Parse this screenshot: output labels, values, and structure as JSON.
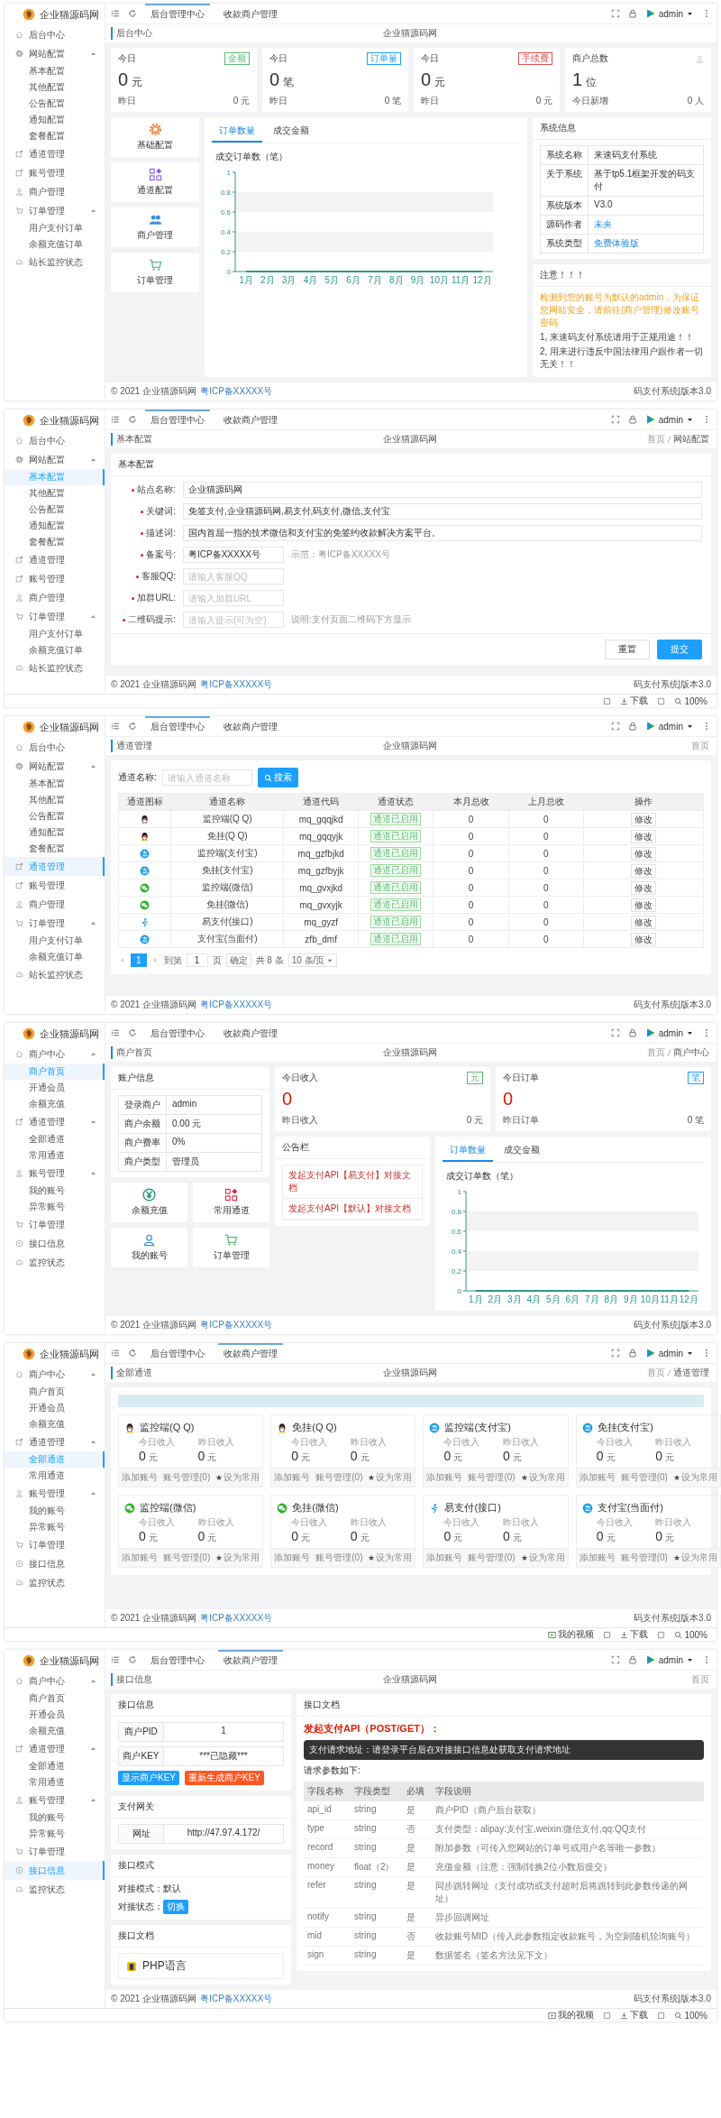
{
  "screens": [
    {
      "kind": "dashboard",
      "brand": "企业猫源码网",
      "user": "admin",
      "tabs": [
        {
          "label": "后台管理中心",
          "selected": true
        },
        {
          "label": "收款商户管理",
          "selected": false
        }
      ],
      "sidebar": [
        {
          "label": "后台中心",
          "kind": "home",
          "selected": false
        },
        {
          "label": "网站配置",
          "kind": "settings",
          "selected": false,
          "expanded": true,
          "children": [
            {
              "label": "基本配置",
              "selected": false
            },
            {
              "label": "其他配置",
              "selected": false
            },
            {
              "label": "公告配置",
              "selected": false
            },
            {
              "label": "通知配置",
              "selected": false
            },
            {
              "label": "套餐配置",
              "selected": false
            }
          ]
        },
        {
          "label": "通道管理",
          "kind": "channel",
          "selected": false
        },
        {
          "label": "账号管理",
          "kind": "channel",
          "selected": false
        },
        {
          "label": "商户管理",
          "kind": "user",
          "selected": false
        },
        {
          "label": "订单管理",
          "kind": "cart",
          "selected": false,
          "expanded": true,
          "children": [
            {
              "label": "用户支付订单",
              "selected": false
            },
            {
              "label": "余额充值订单",
              "selected": false
            }
          ]
        },
        {
          "label": "站长监控状态",
          "kind": "monitor",
          "selected": false
        }
      ],
      "breadcrumb": {
        "title": "后台中心",
        "site": "企业猫源码网"
      },
      "content": {
        "stats": [
          {
            "kind": "badge",
            "label": "今日",
            "badge": "金额",
            "color": "#5fb878",
            "value": "0",
            "unit": "元",
            "sub_label": "昨日",
            "sub_value": "0 元"
          },
          {
            "kind": "badge",
            "label": "今日",
            "badge": "订单量",
            "color": "#1e9fff",
            "value": "0",
            "unit": "笔",
            "sub_label": "昨日",
            "sub_value": "0 笔"
          },
          {
            "kind": "badge",
            "label": "今日",
            "badge": "手续费",
            "color": "#e0504a",
            "value": "0",
            "unit": "元",
            "sub_label": "昨日",
            "sub_value": "0 元"
          },
          {
            "kind": "icon",
            "label": "商户总数",
            "value": "1",
            "unit": "位",
            "sub_label": "今日新增",
            "sub_value": "0 人"
          }
        ],
        "shortcuts": [
          {
            "label": "基础配置",
            "kind": "settings",
            "color": "#ee8a4c"
          },
          {
            "label": "通道配置",
            "kind": "grid",
            "color": "#8b5cf6"
          },
          {
            "label": "商户管理",
            "kind": "users",
            "color": "#3b8fd8"
          },
          {
            "label": "订单管理",
            "kind": "cart",
            "color": "#5fb878"
          }
        ],
        "chart_tabs": [
          {
            "label": "订单数量",
            "selected": true
          },
          {
            "label": "成交金额",
            "selected": false
          }
        ],
        "chart_data": {
          "type": "line",
          "title": "成交订单数（笔）",
          "categories": [
            "1月",
            "2月",
            "3月",
            "4月",
            "5月",
            "6月",
            "7月",
            "8月",
            "9月",
            "10月",
            "11月",
            "12月"
          ],
          "ylim": [
            0,
            1
          ],
          "yticks": [
            0,
            0.2,
            0.4,
            0.6,
            0.8,
            1
          ],
          "series": [
            {
              "color": "#2f9688",
              "values": [
                0,
                0,
                0,
                0,
                0,
                0,
                0,
                0,
                0,
                0,
                0,
                0
              ]
            }
          ]
        },
        "system_info": {
          "title": "系统信息",
          "rows": [
            {
              "key": "系统名称",
              "value": "来速码支付系统",
              "kind": "text"
            },
            {
              "key": "关于系统",
              "value": "基于tp5.1框架开发的码支付",
              "kind": "text"
            },
            {
              "key": "系统版本",
              "value": "V3.0",
              "kind": "text"
            },
            {
              "key": "源码作者",
              "value": "未央",
              "kind": "link"
            },
            {
              "key": "系统类型",
              "value": "免费体验版",
              "kind": "link"
            }
          ]
        },
        "notice": {
          "title": "注意！！！",
          "warning": "检测到您的账号为默认的admin，为保证您网站安全，请前往(商户管理)修改账号密码",
          "lines": [
            "1, 来速码支付系统请用于正规用途！！",
            "2, 用来进行违反中国法律用户跟作者一切无关！！"
          ]
        }
      },
      "footer": {
        "copyright": "© 2021 企业猫源码网",
        "icp": "粤ICP备XXXXX号",
        "version": "码支付系统|版本3.0"
      }
    },
    {
      "kind": "form",
      "brand": "企业猫源码网",
      "user": "admin",
      "tabs": [
        {
          "label": "后台管理中心",
          "selected": true
        },
        {
          "label": "收款商户管理",
          "selected": false
        }
      ],
      "sidebar": [
        {
          "label": "后台中心",
          "kind": "home",
          "selected": false
        },
        {
          "label": "网站配置",
          "kind": "settings",
          "selected": false,
          "expanded": true,
          "children": [
            {
              "label": "基本配置",
              "selected": true
            },
            {
              "label": "其他配置",
              "selected": false
            },
            {
              "label": "公告配置",
              "selected": false
            },
            {
              "label": "通知配置",
              "selected": false
            },
            {
              "label": "套餐配置",
              "selected": false
            }
          ]
        },
        {
          "label": "通道管理",
          "kind": "channel",
          "selected": false
        },
        {
          "label": "账号管理",
          "kind": "channel",
          "selected": false
        },
        {
          "label": "商户管理",
          "kind": "user",
          "selected": false
        },
        {
          "label": "订单管理",
          "kind": "cart",
          "selected": false,
          "expanded": true,
          "children": [
            {
              "label": "用户支付订单",
              "selected": false
            },
            {
              "label": "余额充值订单",
              "selected": false
            }
          ]
        },
        {
          "label": "站长监控状态",
          "kind": "monitor",
          "selected": false
        }
      ],
      "breadcrumb": {
        "title": "基本配置",
        "site": "企业猫源码网",
        "trail": [
          "首页",
          "网站配置"
        ]
      },
      "content": {
        "title": "基本配置",
        "fields": [
          {
            "label": "站点名称:",
            "required": true,
            "kind": "wide",
            "value": "企业猫源码网"
          },
          {
            "label": "关键词:",
            "required": true,
            "kind": "wide",
            "value": "免签支付,企业猫源码网,易支付,码支付,微信,支付宝"
          },
          {
            "label": "描述词:",
            "required": true,
            "kind": "wide",
            "value": "国内首屈一指的技术微信和支付宝的免签约收款解决方案平台。"
          },
          {
            "label": "备案号:",
            "required": true,
            "kind": "short",
            "value": "粤ICP备XXXXX号",
            "hint": "示范：粤ICP备XXXXX号"
          },
          {
            "label": "客服QQ:",
            "required": true,
            "kind": "short",
            "placeholder": "请输入客服QQ"
          },
          {
            "label": "加群URL:",
            "required": true,
            "kind": "short",
            "placeholder": "请输入加群URL"
          },
          {
            "label": "二维码提示:",
            "required": true,
            "kind": "short",
            "placeholder": "请输入提示(可为空)",
            "hint": "说明:支付页面二维码下方显示"
          }
        ],
        "buttons": [
          {
            "label": "重置",
            "kind": "plain"
          },
          {
            "label": "提交",
            "kind": "primary"
          }
        ]
      },
      "footer": {
        "copyright": "© 2021 企业猫源码网",
        "icp": "粤ICP备XXXXX号",
        "version": "码支付系统|版本3.0"
      },
      "status_bar": {
        "download": "下载",
        "zoom": "100%"
      }
    },
    {
      "kind": "table",
      "brand": "企业猫源码网",
      "user": "admin",
      "tabs": [
        {
          "label": "后台管理中心",
          "selected": true
        },
        {
          "label": "收款商户管理",
          "selected": false
        }
      ],
      "sidebar": [
        {
          "label": "后台中心",
          "kind": "home",
          "selected": false
        },
        {
          "label": "网站配置",
          "kind": "settings",
          "selected": false,
          "expanded": true,
          "children": [
            {
              "label": "基本配置",
              "selected": false
            },
            {
              "label": "其他配置",
              "selected": false
            },
            {
              "label": "公告配置",
              "selected": false
            },
            {
              "label": "通知配置",
              "selected": false
            },
            {
              "label": "套餐配置",
              "selected": false
            }
          ]
        },
        {
          "label": "通道管理",
          "kind": "channel",
          "selected": true
        },
        {
          "label": "账号管理",
          "kind": "channel",
          "selected": false
        },
        {
          "label": "商户管理",
          "kind": "user",
          "selected": false
        },
        {
          "label": "订单管理",
          "kind": "cart",
          "selected": false,
          "expanded": true,
          "children": [
            {
              "label": "用户支付订单",
              "selected": false
            },
            {
              "label": "余额充值订单",
              "selected": false
            }
          ]
        },
        {
          "label": "站长监控状态",
          "kind": "monitor",
          "selected": false
        }
      ],
      "breadcrumb": {
        "title": "通道管理",
        "site": "企业猫源码网",
        "trail": [
          "首页"
        ]
      },
      "content": {
        "search": {
          "label": "通道名称:",
          "placeholder": "请输入通道名称",
          "button": "搜索"
        },
        "columns": [
          "通道图标",
          "通道名称",
          "通道代码",
          "通道状态",
          "本月总收",
          "上月总收",
          "操作"
        ],
        "rows": [
          {
            "kind": "qq",
            "name": "监控端(Q Q)",
            "code": "mq_gqqjkd",
            "status": "通道已启用",
            "month": "0",
            "last_month": "0",
            "action": "修改"
          },
          {
            "kind": "qq",
            "name": "免挂(Q Q)",
            "code": "mq_gqqyjk",
            "status": "通道已启用",
            "month": "0",
            "last_month": "0",
            "action": "修改"
          },
          {
            "kind": "alipay",
            "name": "监控端(支付宝)",
            "code": "mq_gzfbjkd",
            "status": "通道已启用",
            "month": "0",
            "last_month": "0",
            "action": "修改"
          },
          {
            "kind": "alipay",
            "name": "免挂(支付宝)",
            "code": "mq_gzfbyjk",
            "status": "通道已启用",
            "month": "0",
            "last_month": "0",
            "action": "修改"
          },
          {
            "kind": "wechat",
            "name": "监控端(微信)",
            "code": "mq_gvxjkd",
            "status": "通道已启用",
            "month": "0",
            "last_month": "0",
            "action": "修改"
          },
          {
            "kind": "wechat",
            "name": "免挂(微信)",
            "code": "mq_gvxyjk",
            "status": "通道已启用",
            "month": "0",
            "last_month": "0",
            "action": "修改"
          },
          {
            "kind": "yzf",
            "name": "易支付(接口)",
            "code": "mq_gyzf",
            "status": "通道已启用",
            "month": "0",
            "last_month": "0",
            "action": "修改"
          },
          {
            "kind": "alipay",
            "name": "支付宝(当面付)",
            "code": "zfb_dmf",
            "status": "通道已启用",
            "month": "0",
            "last_month": "0",
            "action": "修改"
          }
        ],
        "pagination": {
          "pages": [
            {
              "label": "1",
              "selected": true
            }
          ],
          "goto_label": "到第",
          "goto_value": "1",
          "page_unit": "页",
          "confirm": "确定",
          "total": "共 8 条",
          "page_size": "10 条/页"
        }
      },
      "footer": {
        "copyright": "© 2021 企业猫源码网",
        "icp": "粤ICP备XXXXX号",
        "version": "码支付系统|版本3.0"
      }
    },
    {
      "kind": "merchant",
      "brand": "企业猫源码网",
      "user": "admin",
      "tabs": [
        {
          "label": "后台管理中心",
          "selected": false
        },
        {
          "label": "收款商户管理",
          "selected": false
        }
      ],
      "sidebar": [
        {
          "label": "商户中心",
          "kind": "home",
          "selected": false,
          "expanded": true,
          "children": [
            {
              "label": "商户首页",
              "selected": true
            },
            {
              "label": "开通会员",
              "selected": false
            },
            {
              "label": "余额充值",
              "selected": false
            }
          ]
        },
        {
          "label": "通道管理",
          "kind": "channel",
          "selected": false,
          "expanded": true,
          "children": [
            {
              "label": "全部通道",
              "selected": false
            },
            {
              "label": "常用通道",
              "selected": false
            }
          ]
        },
        {
          "label": "账号管理",
          "kind": "user",
          "selected": false,
          "expanded": true,
          "children": [
            {
              "label": "我的账号",
              "selected": false
            },
            {
              "label": "异常账号",
              "selected": false
            }
          ]
        },
        {
          "label": "订单管理",
          "kind": "cart",
          "selected": false
        },
        {
          "label": "接口信息",
          "kind": "info",
          "selected": false
        },
        {
          "label": "监控状态",
          "kind": "monitor",
          "selected": false
        }
      ],
      "breadcrumb": {
        "title": "商户首页",
        "site": "企业猫源码网",
        "trail": [
          "首页",
          "商户中心"
        ]
      },
      "content": {
        "account": {
          "title": "账户信息",
          "rows": [
            {
              "key": "登录商户",
              "value": "admin"
            },
            {
              "key": "商户余额",
              "value": "0.00 元"
            },
            {
              "key": "商户费率",
              "value": "0%"
            },
            {
              "key": "商户类型",
              "value": "管理员"
            }
          ]
        },
        "stats": [
          {
            "label": "今日收入",
            "badge": "元",
            "color": "#5fb878",
            "value": "0",
            "sub_label": "昨日收入",
            "sub_value": "0 元"
          },
          {
            "label": "今日订单",
            "badge": "笔",
            "color": "#1e9fff",
            "value": "0",
            "sub_label": "昨日订单",
            "sub_value": "0 笔"
          }
        ],
        "shortcuts": [
          {
            "label": "余额充值",
            "kind": "yen",
            "color": "#2f9688"
          },
          {
            "label": "常用通道",
            "kind": "grid",
            "color": "#e0284a"
          },
          {
            "label": "我的账号",
            "kind": "user",
            "color": "#3b8fd8"
          },
          {
            "label": "订单管理",
            "kind": "cart",
            "color": "#5fb878"
          }
        ],
        "bulletin": {
          "title": "公告栏",
          "links": [
            "发起支付API【易支付】对接文档",
            "发起支付API【默认】对接文档"
          ]
        },
        "chart_tabs": [
          {
            "label": "订单数量",
            "selected": true
          },
          {
            "label": "成交金额",
            "selected": false
          }
        ],
        "chart_data": {
          "type": "line",
          "title": "成交订单数（笔）",
          "categories": [
            "1月",
            "2月",
            "3月",
            "4月",
            "5月",
            "6月",
            "7月",
            "8月",
            "9月",
            "10月",
            "11月",
            "12月"
          ],
          "ylim": [
            0,
            1
          ],
          "yticks": [
            0,
            0.2,
            0.4,
            0.6,
            0.8,
            1
          ],
          "series": [
            {
              "color": "#2f9688",
              "values": [
                0,
                0,
                0,
                0,
                0,
                0,
                0,
                0,
                0,
                0,
                0,
                0
              ]
            }
          ]
        }
      },
      "footer": {
        "copyright": "© 2021 企业猫源码网",
        "icp": "粤ICP备XXXXX号",
        "version": "码支付系统|版本3.0"
      }
    },
    {
      "kind": "channels",
      "brand": "企业猫源码网",
      "user": "admin",
      "tabs": [
        {
          "label": "后台管理中心",
          "selected": false
        },
        {
          "label": "收款商户管理",
          "selected": true
        }
      ],
      "sidebar": [
        {
          "label": "商户中心",
          "kind": "home",
          "selected": false,
          "expanded": true,
          "children": [
            {
              "label": "商户首页",
              "selected": false
            },
            {
              "label": "开通会员",
              "selected": false
            },
            {
              "label": "余额充值",
              "selected": false
            }
          ]
        },
        {
          "label": "通道管理",
          "kind": "channel",
          "selected": false,
          "expanded": true,
          "children": [
            {
              "label": "全部通道",
              "selected": true
            },
            {
              "label": "常用通道",
              "selected": false
            }
          ]
        },
        {
          "label": "账号管理",
          "kind": "user",
          "selected": false,
          "expanded": true,
          "children": [
            {
              "label": "我的账号",
              "selected": false
            },
            {
              "label": "异常账号",
              "selected": false
            }
          ]
        },
        {
          "label": "订单管理",
          "kind": "cart",
          "selected": false
        },
        {
          "label": "接口信息",
          "kind": "info",
          "selected": false
        },
        {
          "label": "监控状态",
          "kind": "monitor",
          "selected": false
        }
      ],
      "breadcrumb": {
        "title": "全部通道",
        "site": "企业猫源码网",
        "trail": [
          "首页",
          "通道管理"
        ]
      },
      "content": {
        "cards": [
          {
            "kind": "qq",
            "name": "监控端(Q Q)",
            "today_label": "今日收入",
            "today_value": "0",
            "today_unit": "元",
            "yesterday_label": "昨日收入",
            "yesterday_value": "0",
            "yesterday_unit": "元",
            "actions": [
              {
                "label": "添加账号",
                "kind": "plain"
              },
              {
                "label": "账号管理(0)",
                "kind": "plain"
              },
              {
                "label": "设为常用",
                "kind": "star"
              }
            ]
          },
          {
            "kind": "qq",
            "name": "免挂(Q Q)",
            "today_label": "今日收入",
            "today_value": "0",
            "today_unit": "元",
            "yesterday_label": "昨日收入",
            "yesterday_value": "0",
            "yesterday_unit": "元",
            "actions": [
              {
                "label": "添加账号",
                "kind": "plain"
              },
              {
                "label": "账号管理(0)",
                "kind": "plain"
              },
              {
                "label": "设为常用",
                "kind": "star"
              }
            ]
          },
          {
            "kind": "alipay",
            "name": "监控端(支付宝)",
            "today_label": "今日收入",
            "today_value": "0",
            "today_unit": "元",
            "yesterday_label": "昨日收入",
            "yesterday_value": "0",
            "yesterday_unit": "元",
            "actions": [
              {
                "label": "添加账号",
                "kind": "plain"
              },
              {
                "label": "账号管理(0)",
                "kind": "plain"
              },
              {
                "label": "设为常用",
                "kind": "star"
              }
            ]
          },
          {
            "kind": "alipay",
            "name": "免挂(支付宝)",
            "today_label": "今日收入",
            "today_value": "0",
            "today_unit": "元",
            "yesterday_label": "昨日收入",
            "yesterday_value": "0",
            "yesterday_unit": "元",
            "actions": [
              {
                "label": "添加账号",
                "kind": "plain"
              },
              {
                "label": "账号管理(0)",
                "kind": "plain"
              },
              {
                "label": "设为常用",
                "kind": "star"
              }
            ]
          },
          {
            "kind": "wechat",
            "name": "监控端(微信)",
            "today_label": "今日收入",
            "today_value": "0",
            "today_unit": "元",
            "yesterday_label": "昨日收入",
            "yesterday_value": "0",
            "yesterday_unit": "元",
            "actions": [
              {
                "label": "添加账号",
                "kind": "plain"
              },
              {
                "label": "账号管理(0)",
                "kind": "plain"
              },
              {
                "label": "设为常用",
                "kind": "star"
              }
            ]
          },
          {
            "kind": "wechat",
            "name": "免挂(微信)",
            "today_label": "今日收入",
            "today_value": "0",
            "today_unit": "元",
            "yesterday_label": "昨日收入",
            "yesterday_value": "0",
            "yesterday_unit": "元",
            "actions": [
              {
                "label": "添加账号",
                "kind": "plain"
              },
              {
                "label": "账号管理(0)",
                "kind": "plain"
              },
              {
                "label": "设为常用",
                "kind": "star"
              }
            ]
          },
          {
            "kind": "yzf",
            "name": "易支付(接口)",
            "today_label": "今日收入",
            "today_value": "0",
            "today_unit": "元",
            "yesterday_label": "昨日收入",
            "yesterday_value": "0",
            "yesterday_unit": "元",
            "actions": [
              {
                "label": "添加账号",
                "kind": "plain"
              },
              {
                "label": "账号管理(0)",
                "kind": "plain"
              },
              {
                "label": "设为常用",
                "kind": "star"
              }
            ]
          },
          {
            "kind": "alipay",
            "name": "支付宝(当面付)",
            "today_label": "今日收入",
            "today_value": "0",
            "today_unit": "元",
            "yesterday_label": "昨日收入",
            "yesterday_value": "0",
            "yesterday_unit": "元",
            "actions": [
              {
                "label": "添加账号",
                "kind": "plain"
              },
              {
                "label": "账号管理(0)",
                "kind": "plain"
              },
              {
                "label": "设为常用",
                "kind": "star"
              }
            ]
          }
        ]
      },
      "footer": {
        "copyright": "© 2021 企业猫源码网",
        "icp": "粤ICP备XXXXX号",
        "version": "码支付系统|版本3.0"
      },
      "status_bar": {
        "video": "我的视频",
        "download": "下载",
        "zoom": "100%"
      }
    },
    {
      "kind": "api",
      "brand": "企业猫源码网",
      "user": "admin",
      "tabs": [
        {
          "label": "后台管理中心",
          "selected": false
        },
        {
          "label": "收款商户管理",
          "selected": true
        }
      ],
      "sidebar": [
        {
          "label": "商户中心",
          "kind": "home",
          "selected": false,
          "expanded": true,
          "children": [
            {
              "label": "商户首页",
              "selected": false
            },
            {
              "label": "开通会员",
              "selected": false
            },
            {
              "label": "余额充值",
              "selected": false
            }
          ]
        },
        {
          "label": "通道管理",
          "kind": "channel",
          "selected": false,
          "expanded": true,
          "children": [
            {
              "label": "全部通道",
              "selected": false
            },
            {
              "label": "常用通道",
              "selected": false
            }
          ]
        },
        {
          "label": "账号管理",
          "kind": "user",
          "selected": false,
          "expanded": true,
          "children": [
            {
              "label": "我的账号",
              "selected": false
            },
            {
              "label": "异常账号",
              "selected": false
            }
          ]
        },
        {
          "label": "订单管理",
          "kind": "cart",
          "selected": false
        },
        {
          "label": "接口信息",
          "kind": "info",
          "selected": true
        },
        {
          "label": "监控状态",
          "kind": "monitor",
          "selected": false
        }
      ],
      "breadcrumb": {
        "title": "接口信息",
        "site": "企业猫源码网",
        "trail": [
          "首页"
        ]
      },
      "content": {
        "info": {
          "title": "接口信息",
          "rows": [
            {
              "key": "商户PID",
              "value": "1"
            },
            {
              "key": "商户KEY",
              "value": "***已隐藏***"
            }
          ],
          "buttons": [
            {
              "label": "显示商户KEY",
              "color": "#1e9fff"
            },
            {
              "label": "重新生成商户KEY",
              "color": "#ff5722"
            }
          ]
        },
        "gateway": {
          "title": "支付网关",
          "rows": [
            {
              "key": "网址",
              "value": "http://47.97.4.172/"
            }
          ]
        },
        "mode": {
          "title": "接口模式",
          "mode_label": "对接模式：默认",
          "status_label": "对接状态：",
          "status_button": "切换"
        },
        "docs": {
          "title": "接口文档",
          "items": [
            {
              "label": "PHP语言",
              "kind": "php"
            }
          ]
        },
        "api_doc": {
          "title": "接口文档",
          "heading": "发起支付API（POST/GET）：",
          "address": "支付请求地址：请登录平台后在对接接口信息处获取支付请求地址",
          "params_label": "请求参数如下:",
          "columns": [
            "字段名称",
            "字段类型",
            "必填",
            "字段说明"
          ],
          "rows": [
            [
              "api_id",
              "string",
              "是",
              "商户PID（商户后台获取）"
            ],
            [
              "type",
              "string",
              "否",
              "支付类型：alipay:支付宝,weixin:微信支付,qq:QQ支付"
            ],
            [
              "record",
              "string",
              "是",
              "附加参数（可传入您网站的订单号或用户名等唯一参数）"
            ],
            [
              "money",
              "float（2）",
              "是",
              "充值金额（注意：强制转换2位小数后提交）"
            ],
            [
              "refer",
              "string",
              "是",
              "同步跳转网址（支付成功或支付超时后将跳转到此参数传递的网址）"
            ],
            [
              "notify",
              "string",
              "是",
              "异步回调网址"
            ],
            [
              "mid",
              "string",
              "否",
              "收款账号MID（传入此参数指定收款账号，为空则随机轮询账号）"
            ],
            [
              "sign",
              "string",
              "是",
              "数据签名（签名方法见下文）"
            ]
          ]
        }
      },
      "footer": {
        "copyright": "© 2021 企业猫源码网",
        "icp": "粤ICP备XXXXX号",
        "version": "码支付系统|版本3.0"
      },
      "status_bar": {
        "video": "我的视频",
        "download": "下载",
        "zoom": "100%"
      }
    }
  ]
}
